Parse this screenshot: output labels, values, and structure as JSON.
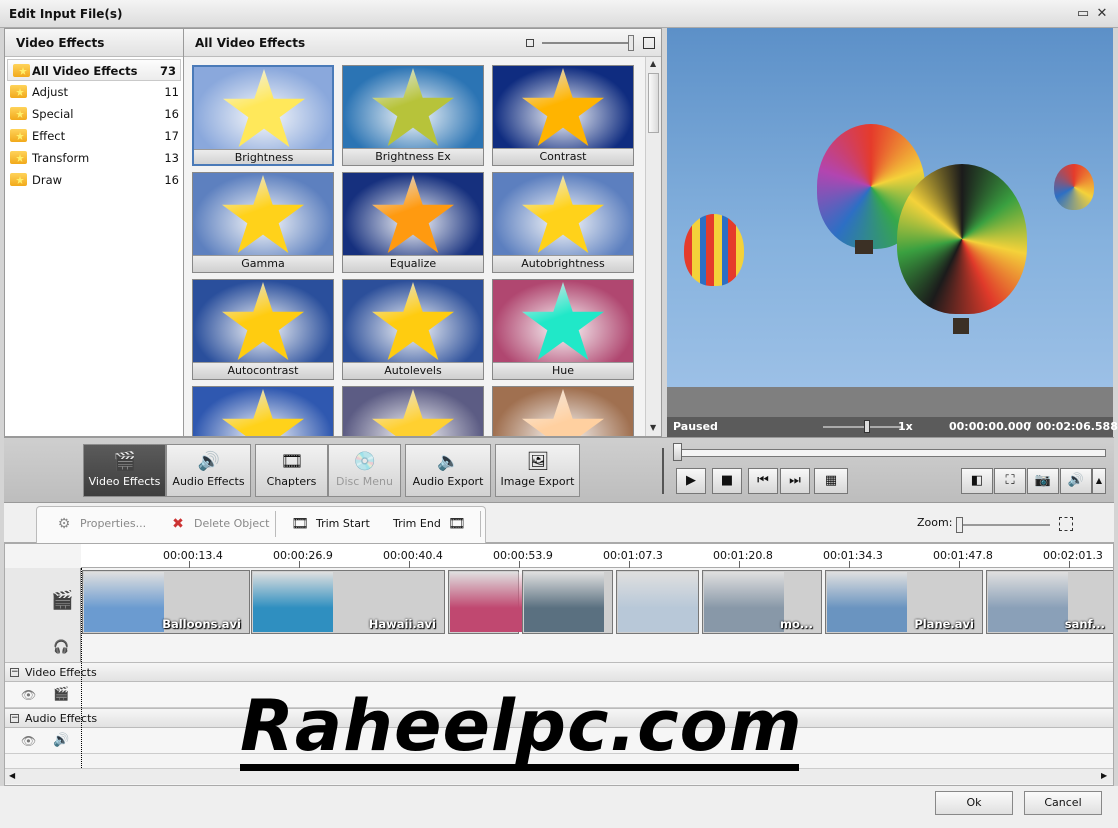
{
  "window": {
    "title": "Edit Input File(s)"
  },
  "categories": {
    "header": "Video Effects",
    "items": [
      {
        "label": "All Video Effects",
        "count": "73"
      },
      {
        "label": "Adjust",
        "count": "11"
      },
      {
        "label": "Special",
        "count": "16"
      },
      {
        "label": "Effect",
        "count": "17"
      },
      {
        "label": "Transform",
        "count": "13"
      },
      {
        "label": "Draw",
        "count": "16"
      }
    ]
  },
  "effects": {
    "header": "All Video Effects",
    "tiles": [
      {
        "label": "Brightness",
        "bg": "#8aa8dc",
        "star": "#ffe85a"
      },
      {
        "label": "Brightness Ex",
        "bg": "#2b74b4",
        "star": "#b7c33a"
      },
      {
        "label": "Contrast",
        "bg": "#0f2c80",
        "star": "#ffb400"
      },
      {
        "label": "Gamma",
        "bg": "#5d80bf",
        "star": "#ffd21a"
      },
      {
        "label": "Equalize",
        "bg": "#16307e",
        "star": "#ff9a10"
      },
      {
        "label": "Autobrightness",
        "bg": "#5c7fbf",
        "star": "#ffd21a"
      },
      {
        "label": "Autocontrast",
        "bg": "#2a4f9c",
        "star": "#ffcc10"
      },
      {
        "label": "Autolevels",
        "bg": "#2c4f9a",
        "star": "#ffcc10"
      },
      {
        "label": "Hue",
        "bg": "#b04770",
        "star": "#20e8c8"
      },
      {
        "label": "",
        "bg": "#2f58b0",
        "star": "#ffd21a"
      },
      {
        "label": "",
        "bg": "#5c5c84",
        "star": "#ffd030"
      },
      {
        "label": "",
        "bg": "#a07050",
        "star": "#ffd0a0"
      }
    ]
  },
  "player": {
    "status": "Paused",
    "speed": "1x",
    "time_current": "00:00:00.000",
    "time_sep": "/",
    "time_total": "00:02:06.588"
  },
  "toolbar": {
    "video_effects": "Video Effects",
    "audio_effects": "Audio Effects",
    "chapters": "Chapters",
    "disc_menu": "Disc Menu",
    "audio_export": "Audio Export",
    "image_export": "Image Export"
  },
  "editbar": {
    "properties": "Properties...",
    "delete": "Delete Object",
    "trim_start": "Trim Start",
    "trim_end": "Trim End",
    "zoom": "Zoom:"
  },
  "timeline": {
    "ticks": [
      "00:00:13.4",
      "00:00:26.9",
      "00:00:40.4",
      "00:00:53.9",
      "00:01:07.3",
      "00:01:20.8",
      "00:01:34.3",
      "00:01:47.8",
      "00:02:01.3"
    ],
    "clips": [
      {
        "name": "Balloons.avi",
        "color": "#6b9bd0"
      },
      {
        "name": "Hawaii.avi",
        "color": "#2f8fc0"
      },
      {
        "name": "",
        "color": "#c04870"
      },
      {
        "name": "",
        "color": "#5a7080"
      },
      {
        "name": "",
        "color": "#b8c8d8"
      },
      {
        "name": "mo...",
        "color": "#8898a8"
      },
      {
        "name": "Plane.avi",
        "color": "#6a94c0"
      },
      {
        "name": "sanf...",
        "color": "#8aa0b8"
      }
    ],
    "video_effects_label": "Video Effects",
    "audio_effects_label": "Audio Effects"
  },
  "watermark": "Raheelpc.com",
  "buttons": {
    "ok": "Ok",
    "cancel": "Cancel"
  }
}
